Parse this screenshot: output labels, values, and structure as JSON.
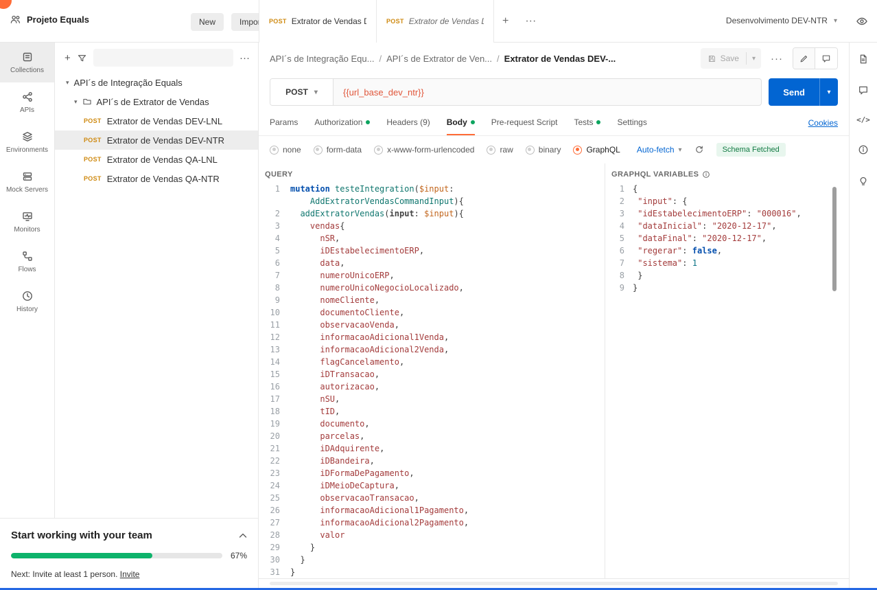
{
  "topbar": {
    "workspace": "Projeto Equals",
    "new_label": "New",
    "import_label": "Import",
    "env_label": "Desenvolvimento DEV-NTR"
  },
  "tabs": [
    {
      "method": "POST",
      "title": "Extrator de Vendas DEV",
      "active": true,
      "preview": false
    },
    {
      "method": "POST",
      "title": "Extrator de Vendas DEV",
      "active": false,
      "preview": true
    }
  ],
  "rail": [
    {
      "label": "Collections",
      "icon": "collections-icon",
      "active": true
    },
    {
      "label": "APIs",
      "icon": "apis-icon",
      "active": false
    },
    {
      "label": "Environments",
      "icon": "environments-icon",
      "active": false
    },
    {
      "label": "Mock Servers",
      "icon": "mock-servers-icon",
      "active": false
    },
    {
      "label": "Monitors",
      "icon": "monitors-icon",
      "active": false
    },
    {
      "label": "Flows",
      "icon": "flows-icon",
      "active": false
    },
    {
      "label": "History",
      "icon": "history-icon",
      "active": false
    }
  ],
  "sidebar": {
    "root": "API´s de Integração Equals",
    "folder": "API´s de Extrator de Vendas",
    "requests": [
      {
        "method": "POST",
        "name": "Extrator de Vendas DEV-LNL",
        "selected": false
      },
      {
        "method": "POST",
        "name": "Extrator de Vendas DEV-NTR",
        "selected": true
      },
      {
        "method": "POST",
        "name": "Extrator de Vendas QA-LNL",
        "selected": false
      },
      {
        "method": "POST",
        "name": "Extrator de Vendas QA-NTR",
        "selected": false
      }
    ]
  },
  "breadcrumb": [
    "API´s de Integração Equ...",
    "API´s de Extrator de Ven...",
    "Extrator de Vendas DEV-..."
  ],
  "toolbar": {
    "save_label": "Save"
  },
  "request": {
    "method": "POST",
    "url": "{{url_base_dev_ntr}}",
    "send_label": "Send"
  },
  "req_tabs": {
    "items": [
      {
        "label": "Params",
        "dot": false,
        "active": false
      },
      {
        "label": "Authorization",
        "dot": true,
        "active": false
      },
      {
        "label": "Headers (9)",
        "dot": false,
        "active": false
      },
      {
        "label": "Body",
        "dot": true,
        "active": true
      },
      {
        "label": "Pre-request Script",
        "dot": false,
        "active": false
      },
      {
        "label": "Tests",
        "dot": true,
        "active": false
      },
      {
        "label": "Settings",
        "dot": false,
        "active": false
      }
    ],
    "cookies_label": "Cookies"
  },
  "body_bar": {
    "options": [
      "none",
      "form-data",
      "x-www-form-urlencoded",
      "raw",
      "binary",
      "GraphQL"
    ],
    "selected": "GraphQL",
    "autofetch_label": "Auto-fetch",
    "schema_status": "Schema Fetched"
  },
  "query": {
    "label": "QUERY",
    "lines": [
      {
        "n": "1",
        "t": [
          [
            "kw",
            "mutation"
          ],
          [
            "plain",
            " "
          ],
          [
            "name",
            "testeIntegration"
          ],
          [
            "plain",
            "("
          ],
          [
            "var",
            "$input"
          ],
          [
            "plain",
            ":"
          ]
        ]
      },
      {
        "n": "",
        "t": [
          [
            "plain",
            "    "
          ],
          [
            "name",
            "AddExtratorVendasCommandInput"
          ],
          [
            "plain",
            "){"
          ]
        ]
      },
      {
        "n": "2",
        "t": [
          [
            "plain",
            "  "
          ],
          [
            "name",
            "addExtratorVendas"
          ],
          [
            "plain",
            "("
          ],
          [
            "attr",
            "input"
          ],
          [
            "plain",
            ": "
          ],
          [
            "var",
            "$input"
          ],
          [
            "plain",
            "){"
          ]
        ]
      },
      {
        "n": "3",
        "t": [
          [
            "plain",
            "    "
          ],
          [
            "field",
            "vendas"
          ],
          [
            "plain",
            "{"
          ]
        ]
      },
      {
        "n": "4",
        "t": [
          [
            "plain",
            "      "
          ],
          [
            "field",
            "nSR"
          ],
          [
            "plain",
            ","
          ]
        ]
      },
      {
        "n": "5",
        "t": [
          [
            "plain",
            "      "
          ],
          [
            "field",
            "iDEstabelecimentoERP"
          ],
          [
            "plain",
            ","
          ]
        ]
      },
      {
        "n": "6",
        "t": [
          [
            "plain",
            "      "
          ],
          [
            "field",
            "data"
          ],
          [
            "plain",
            ","
          ]
        ]
      },
      {
        "n": "7",
        "t": [
          [
            "plain",
            "      "
          ],
          [
            "field",
            "numeroUnicoERP"
          ],
          [
            "plain",
            ","
          ]
        ]
      },
      {
        "n": "8",
        "t": [
          [
            "plain",
            "      "
          ],
          [
            "field",
            "numeroUnicoNegocioLocalizado"
          ],
          [
            "plain",
            ","
          ]
        ]
      },
      {
        "n": "9",
        "t": [
          [
            "plain",
            "      "
          ],
          [
            "field",
            "nomeCliente"
          ],
          [
            "plain",
            ","
          ]
        ]
      },
      {
        "n": "10",
        "t": [
          [
            "plain",
            "      "
          ],
          [
            "field",
            "documentoCliente"
          ],
          [
            "plain",
            ","
          ]
        ]
      },
      {
        "n": "11",
        "t": [
          [
            "plain",
            "      "
          ],
          [
            "field",
            "observacaoVenda"
          ],
          [
            "plain",
            ","
          ]
        ]
      },
      {
        "n": "12",
        "t": [
          [
            "plain",
            "      "
          ],
          [
            "field",
            "informacaoAdicional1Venda"
          ],
          [
            "plain",
            ","
          ]
        ]
      },
      {
        "n": "13",
        "t": [
          [
            "plain",
            "      "
          ],
          [
            "field",
            "informacaoAdicional2Venda"
          ],
          [
            "plain",
            ","
          ]
        ]
      },
      {
        "n": "14",
        "t": [
          [
            "plain",
            "      "
          ],
          [
            "field",
            "flagCancelamento"
          ],
          [
            "plain",
            ","
          ]
        ]
      },
      {
        "n": "15",
        "t": [
          [
            "plain",
            "      "
          ],
          [
            "field",
            "iDTransacao"
          ],
          [
            "plain",
            ","
          ]
        ]
      },
      {
        "n": "16",
        "t": [
          [
            "plain",
            "      "
          ],
          [
            "field",
            "autorizacao"
          ],
          [
            "plain",
            ","
          ]
        ]
      },
      {
        "n": "17",
        "t": [
          [
            "plain",
            "      "
          ],
          [
            "field",
            "nSU"
          ],
          [
            "plain",
            ","
          ]
        ]
      },
      {
        "n": "18",
        "t": [
          [
            "plain",
            "      "
          ],
          [
            "field",
            "tID"
          ],
          [
            "plain",
            ","
          ]
        ]
      },
      {
        "n": "19",
        "t": [
          [
            "plain",
            "      "
          ],
          [
            "field",
            "documento"
          ],
          [
            "plain",
            ","
          ]
        ]
      },
      {
        "n": "20",
        "t": [
          [
            "plain",
            "      "
          ],
          [
            "field",
            "parcelas"
          ],
          [
            "plain",
            ","
          ]
        ]
      },
      {
        "n": "21",
        "t": [
          [
            "plain",
            "      "
          ],
          [
            "field",
            "iDAdquirente"
          ],
          [
            "plain",
            ","
          ]
        ]
      },
      {
        "n": "22",
        "t": [
          [
            "plain",
            "      "
          ],
          [
            "field",
            "iDBandeira"
          ],
          [
            "plain",
            ","
          ]
        ]
      },
      {
        "n": "23",
        "t": [
          [
            "plain",
            "      "
          ],
          [
            "field",
            "iDFormaDePagamento"
          ],
          [
            "plain",
            ","
          ]
        ]
      },
      {
        "n": "24",
        "t": [
          [
            "plain",
            "      "
          ],
          [
            "field",
            "iDMeioDeCaptura"
          ],
          [
            "plain",
            ","
          ]
        ]
      },
      {
        "n": "25",
        "t": [
          [
            "plain",
            "      "
          ],
          [
            "field",
            "observacaoTransacao"
          ],
          [
            "plain",
            ","
          ]
        ]
      },
      {
        "n": "26",
        "t": [
          [
            "plain",
            "      "
          ],
          [
            "field",
            "informacaoAdicional1Pagamento"
          ],
          [
            "plain",
            ","
          ]
        ]
      },
      {
        "n": "27",
        "t": [
          [
            "plain",
            "      "
          ],
          [
            "field",
            "informacaoAdicional2Pagamento"
          ],
          [
            "plain",
            ","
          ]
        ]
      },
      {
        "n": "28",
        "t": [
          [
            "plain",
            "      "
          ],
          [
            "field",
            "valor"
          ]
        ]
      },
      {
        "n": "29",
        "t": [
          [
            "plain",
            "    }"
          ]
        ]
      },
      {
        "n": "30",
        "t": [
          [
            "plain",
            "  }"
          ]
        ]
      },
      {
        "n": "31",
        "t": [
          [
            "plain",
            "}"
          ]
        ]
      }
    ]
  },
  "variables": {
    "label": "GRAPHQL VARIABLES",
    "lines": [
      {
        "n": "1",
        "t": [
          [
            "plain",
            "{"
          ]
        ]
      },
      {
        "n": "2",
        "t": [
          [
            "plain",
            " "
          ],
          [
            "key",
            "\"input\""
          ],
          [
            "plain",
            ": {"
          ]
        ]
      },
      {
        "n": "3",
        "t": [
          [
            "plain",
            " "
          ],
          [
            "key",
            "\"idEstabelecimentoERP\""
          ],
          [
            "plain",
            ": "
          ],
          [
            "str",
            "\"000016\""
          ],
          [
            "plain",
            ","
          ]
        ]
      },
      {
        "n": "4",
        "t": [
          [
            "plain",
            " "
          ],
          [
            "key",
            "\"dataInicial\""
          ],
          [
            "plain",
            ": "
          ],
          [
            "str",
            "\"2020-12-17\""
          ],
          [
            "plain",
            ","
          ]
        ]
      },
      {
        "n": "5",
        "t": [
          [
            "plain",
            " "
          ],
          [
            "key",
            "\"dataFinal\""
          ],
          [
            "plain",
            ": "
          ],
          [
            "str",
            "\"2020-12-17\""
          ],
          [
            "plain",
            ","
          ]
        ]
      },
      {
        "n": "6",
        "t": [
          [
            "plain",
            " "
          ],
          [
            "key",
            "\"regerar\""
          ],
          [
            "plain",
            ": "
          ],
          [
            "bool",
            "false"
          ],
          [
            "plain",
            ","
          ]
        ]
      },
      {
        "n": "7",
        "t": [
          [
            "plain",
            " "
          ],
          [
            "key",
            "\"sistema\""
          ],
          [
            "plain",
            ": "
          ],
          [
            "num",
            "1"
          ]
        ]
      },
      {
        "n": "8",
        "t": [
          [
            "plain",
            " }"
          ]
        ]
      },
      {
        "n": "9",
        "t": [
          [
            "plain",
            "}"
          ]
        ]
      }
    ]
  },
  "onboarding": {
    "title": "Start working with your team",
    "progress_pct": 67,
    "progress_label": "67%",
    "next_text": "Next: Invite at least 1 person.",
    "invite_label": "Invite"
  },
  "colors": {
    "accent_orange": "#ff6c37",
    "primary_blue": "#0265d2",
    "success_green": "#0da45f",
    "post_amber": "#cf8a11"
  }
}
